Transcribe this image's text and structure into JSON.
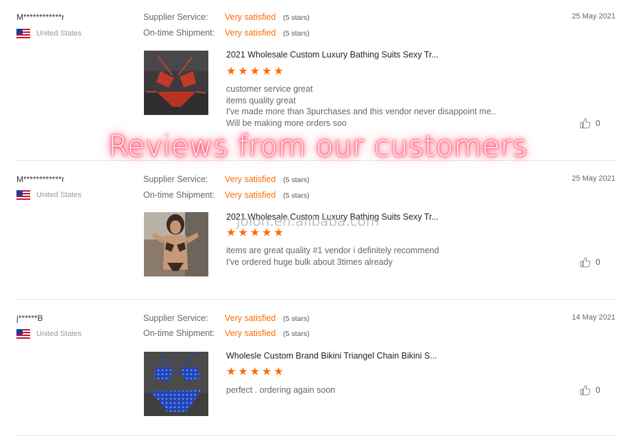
{
  "banner": {
    "text": "Reviews from our customers"
  },
  "watermark": {
    "text": "jolon.en.alibaba.com"
  },
  "labels": {
    "supplier_service": "Supplier Service:",
    "ontime_shipment": "On-time Shipment:"
  },
  "colors": {
    "accent": "#ff6a00",
    "divider": "#e4e4e4",
    "banner_glow": "#ff2d55"
  },
  "reviews": [
    {
      "username": "M************r",
      "country": "United States",
      "date": "25 May 2021",
      "supplier_service": {
        "value": "Very satisfied",
        "stars_text": "(5 stars)"
      },
      "ontime_shipment": {
        "value": "Very satisfied",
        "stars_text": "(5 stars)"
      },
      "product_title": "2021 Wholesale Custom Luxury Bathing Suits Sexy Tr...",
      "product_rating": 5,
      "comment_lines": [
        "customer service great",
        "items quality great",
        "I've made more than 3purchases and this vendor never disappoint me..",
        "Will be making more orders soo"
      ],
      "likes": "0"
    },
    {
      "username": "M************r",
      "country": "United States",
      "date": "25 May 2021",
      "supplier_service": {
        "value": "Very satisfied",
        "stars_text": "(5 stars)"
      },
      "ontime_shipment": {
        "value": "Very satisfied",
        "stars_text": "(5 stars)"
      },
      "product_title": "2021 Wholesale Custom Luxury Bathing Suits Sexy Tr...",
      "product_rating": 5,
      "comment_lines": [
        "items are great quality #1 vendor i definitely recommend",
        "I've ordered huge bulk about 3times already"
      ],
      "likes": "0"
    },
    {
      "username": "j******B",
      "country": "United States",
      "date": "14 May 2021",
      "supplier_service": {
        "value": "Very satisfied",
        "stars_text": "(5 stars)"
      },
      "ontime_shipment": {
        "value": "Very satisfied",
        "stars_text": "(5 stars)"
      },
      "product_title": "Wholesle Custom Brand Bikini Triangel Chain Bikini S...",
      "product_rating": 5,
      "comment_lines": [
        "perfect . ordering again soon"
      ],
      "likes": "0"
    }
  ]
}
